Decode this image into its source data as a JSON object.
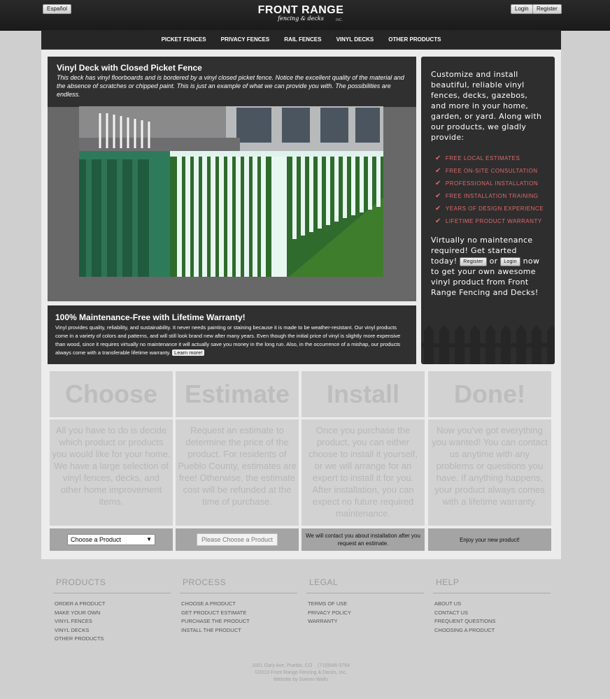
{
  "header": {
    "language_button": "Español",
    "logo_title": "FRONT RANGE",
    "logo_subtitle": "fencing & decks",
    "logo_inc": "INC.",
    "login_button": "Login",
    "register_button": "Register"
  },
  "nav": {
    "items": [
      "PICKET FENCES",
      "PRIVACY FENCES",
      "RAIL FENCES",
      "VINYL DECKS",
      "OTHER PRODUCTS"
    ]
  },
  "feature": {
    "title": "Vinyl Deck with Closed Picket Fence",
    "description": "This deck has vinyl floorboards and is bordered by a vinyl closed picket fence. Notice the excellent quality of the material and the absence of scratches or chipped paint. This is just an example of what we can provide you with. The possibilities are endless."
  },
  "warranty": {
    "title": "100% Maintenance-Free with Lifetime Warranty!",
    "text": "Vinyl provides quality, reliability, and sustainability. It never needs painting or staining because it is made to be weather-resistant. Our vinyl products come in a variety of colors and patterns, and will still look brand new after many years. Even though the initial price of vinyl is slightly more expensive than wood, since it requires virtually no maintenance it will actually save you money in the long run. Also, in the occurrence of a mishap, our products always come with a transferable lifetime warranty.",
    "learn_more": "Learn more!"
  },
  "sidebar": {
    "intro": "Customize and install beautiful, reliable vinyl fences, decks, gazebos, and more in your home, garden, or yard. Along with our products, we gladly provide:",
    "benefits": [
      "FREE LOCAL ESTIMATES",
      "FREE ON-SITE CONSULTATION",
      "PROFESSIONAL INSTALLATION",
      "FREE INSTALLATION TRAINING",
      "YEARS OF DESIGN EXPERIENCE",
      "LIFETIME PRODUCT WARRANTY"
    ],
    "outro_1": "Virtually no maintenance required! Get started today!",
    "register": "Register",
    "or": "or",
    "login": "Login",
    "outro_2": "now to get your own awesome vinyl product from Front Range Fencing and Decks!"
  },
  "steps": [
    {
      "title": "Choose",
      "body": "All you have to do is decide which product or products you would like for your home. We have a large selection of vinyl fences, decks, and other home improvement items.",
      "action": "Choose a Product"
    },
    {
      "title": "Estimate",
      "body": "Request an estimate to determine the price of the product. For residents of Pueblo County, estimates are free! Otherwise, the estimate cost will be refunded at the time of purchase.",
      "action": "Please Choose a Product"
    },
    {
      "title": "Install",
      "body": "Once you purchase the product, you can either choose to install it yourself, or we will arrange for an expert to install it for you. After installation, you can expect no future required maintenance.",
      "action": "We will contact you about installation after you request an estimate."
    },
    {
      "title": "Done!",
      "body": "Now you've got everything you wanted! You can contact us anytime with any problems or questions you have. If anything happens, your product always comes with a lifetime warranty.",
      "action": "Enjoy your new product!"
    }
  ],
  "footer": {
    "columns": [
      {
        "title": "PRODUCTS",
        "links": [
          "ORDER A PRODUCT",
          "MAKE YOUR OWN",
          "VINYL FENCES",
          "VINYL DECKS",
          "OTHER PRODUCTS"
        ]
      },
      {
        "title": "PROCESS",
        "links": [
          "CHOOSE A PRODUCT",
          "GET PRODUCT ESTIMATE",
          "PURCHASE THE PRODUCT",
          "INSTALL THE PRODUCT"
        ]
      },
      {
        "title": "LEGAL",
        "links": [
          "TERMS OF USE",
          "PRIVACY POLICY",
          "WARRANTY"
        ]
      },
      {
        "title": "HELP",
        "links": [
          "ABOUT US",
          "CONTACT US",
          "FREQUENT QUESTIONS",
          "CHOOSING A PRODUCT"
        ]
      }
    ],
    "address": "1001 Gary Ave. Pueblo, CO    (719)546-3764",
    "copyright": "©2013 Front Range Fencing & Decks, Inc.",
    "credit": "Website by Soeren Walls"
  },
  "colors": {
    "accent_red": "#e06a6a",
    "header_dark": "#1f1f1f",
    "panel_dark": "#303030"
  }
}
